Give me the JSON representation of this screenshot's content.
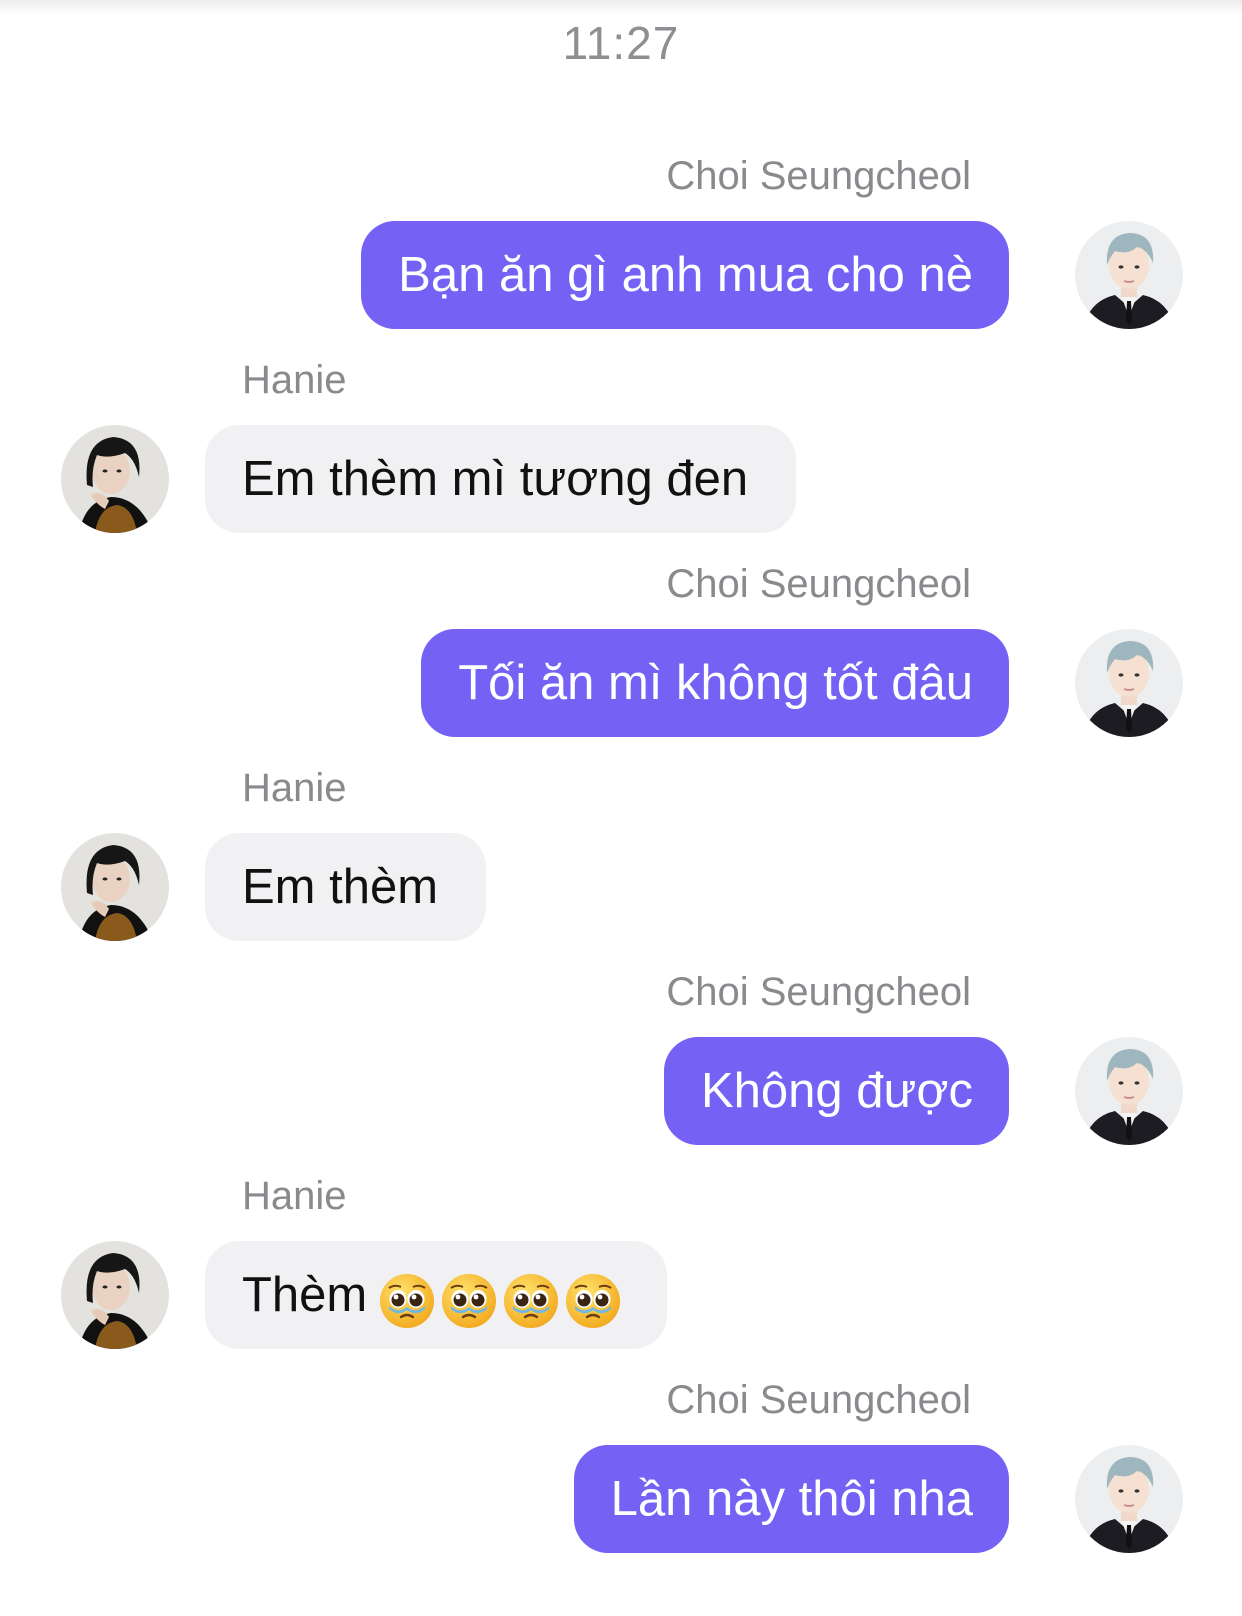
{
  "chat": {
    "time": "11:27",
    "colors": {
      "outgoing_bubble": "#7561f4",
      "incoming_bubble": "#f1f1f3",
      "sender_name": "#8a8a8e"
    },
    "messages": [
      {
        "sender": "Choi Seungcheol",
        "text": "Bạn ăn gì anh mua cho nè",
        "side": "right",
        "avatar": "seungcheol-avatar"
      },
      {
        "sender": "Hanie",
        "text": "Em thèm mì tương đen",
        "side": "left",
        "avatar": "hanie-avatar"
      },
      {
        "sender": "Choi Seungcheol",
        "text": "Tối ăn mì không tốt đâu",
        "side": "right",
        "avatar": "seungcheol-avatar"
      },
      {
        "sender": "Hanie",
        "text": "Em thèm",
        "side": "left",
        "avatar": "hanie-avatar"
      },
      {
        "sender": "Choi Seungcheol",
        "text": "Không được",
        "side": "right",
        "avatar": "seungcheol-avatar"
      },
      {
        "sender": "Hanie",
        "text": "Thèm",
        "emoji": "pleading-face-emoji",
        "emoji_count": 4,
        "side": "left",
        "avatar": "hanie-avatar"
      },
      {
        "sender": "Choi Seungcheol",
        "text": "Lần này thôi nha",
        "side": "right",
        "avatar": "seungcheol-avatar"
      }
    ]
  }
}
